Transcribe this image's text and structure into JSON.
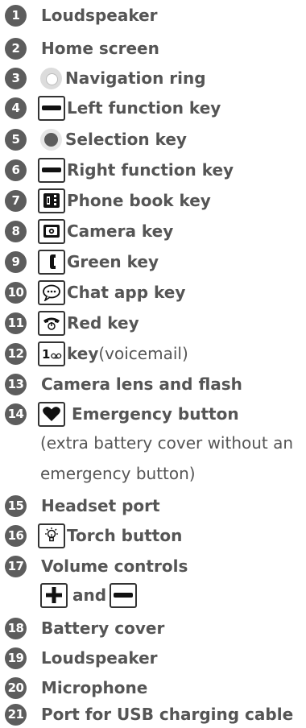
{
  "items": [
    {
      "num": "1",
      "label": "Loudspeaker"
    },
    {
      "num": "2",
      "label": "Home screen"
    },
    {
      "num": "3",
      "label": "Navigation ring",
      "icon": "navigation-ring-icon"
    },
    {
      "num": "4",
      "label": "Left function key",
      "icon": "minus-key-icon"
    },
    {
      "num": "5",
      "label": "Selection key",
      "icon": "selection-key-icon"
    },
    {
      "num": "6",
      "label": "Right function key",
      "icon": "minus-key-icon"
    },
    {
      "num": "7",
      "label": "Phone book key",
      "icon": "phone-book-icon"
    },
    {
      "num": "8",
      "label": "Camera key",
      "icon": "camera-icon"
    },
    {
      "num": "9",
      "label": "Green key",
      "icon": "green-handset-icon"
    },
    {
      "num": "10",
      "label": "Chat app key",
      "icon": "chat-bubble-icon"
    },
    {
      "num": "11",
      "label": "Red key",
      "icon": "red-handset-icon"
    },
    {
      "num": "12",
      "label": "key",
      "suffix": " (voicemail)",
      "icon": "voicemail-1-key-icon"
    },
    {
      "num": "13",
      "label": "Camera lens and flash"
    },
    {
      "num": "14",
      "label": "Emergency button",
      "icon": "heart-icon"
    },
    {
      "num": "15",
      "label": "Headset port"
    },
    {
      "num": "16",
      "label": "Torch button",
      "icon": "torch-bulb-icon"
    },
    {
      "num": "17",
      "label": "Volume controls"
    },
    {
      "num": "18",
      "label": "Battery cover"
    },
    {
      "num": "19",
      "label": "Loudspeaker"
    },
    {
      "num": "20",
      "label": "Microphone"
    },
    {
      "num": "21",
      "label": "Port for USB charging cable"
    }
  ],
  "emergency_note": {
    "line1": "(extra battery cover without an",
    "line2": "emergency button)"
  },
  "volume": {
    "plus_icon": "plus-key-icon",
    "and_text": "and",
    "minus_icon": "minus-key-icon"
  },
  "colors": {
    "text": "#555555",
    "badge": "#5d5d5d",
    "icon_border": "#333333"
  }
}
